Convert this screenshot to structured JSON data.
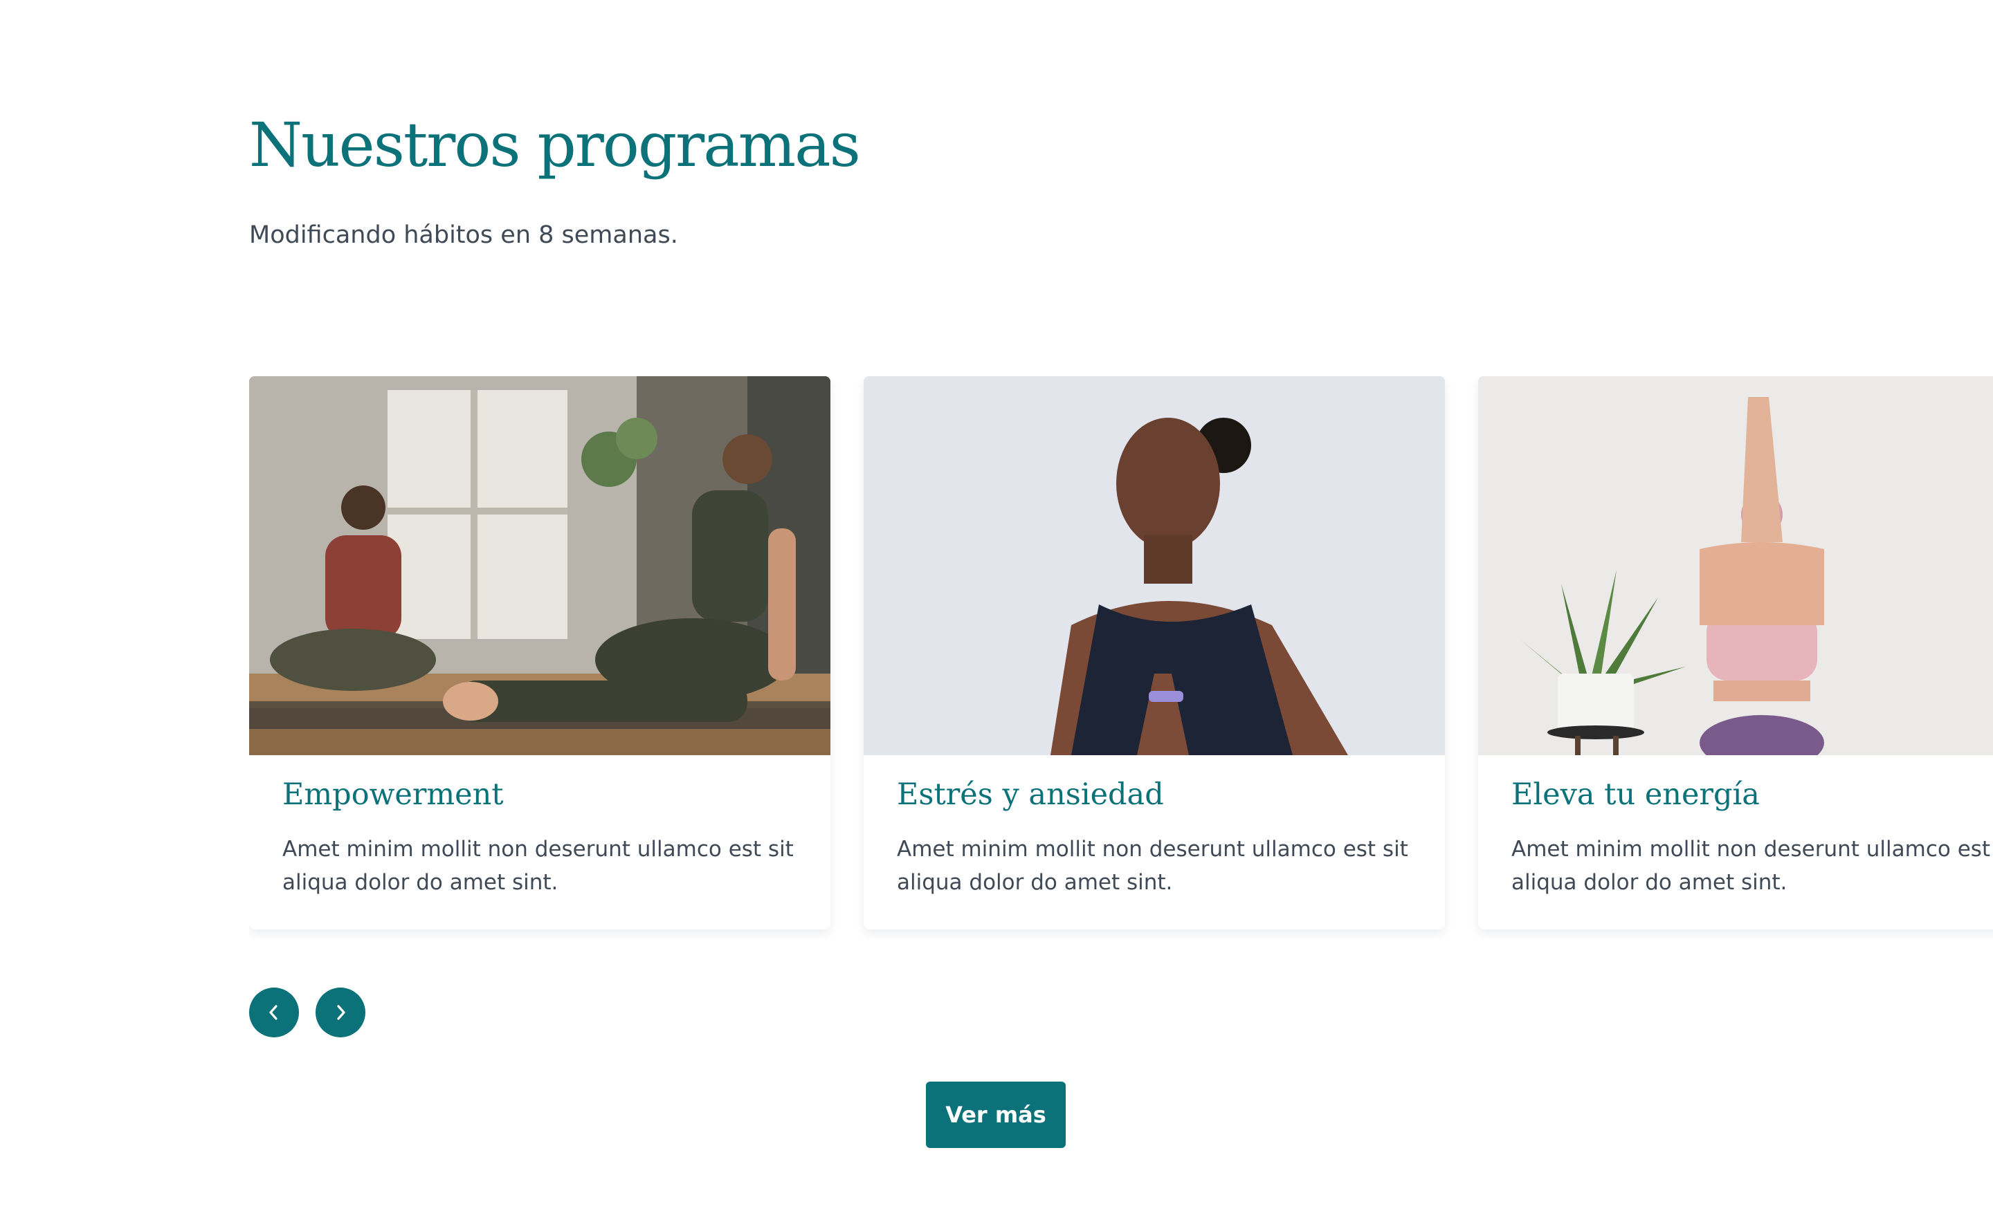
{
  "section": {
    "title": "Nuestros programas",
    "subtitle": "Modificando hábitos en 8 semanas."
  },
  "programs": [
    {
      "title": "Empowerment",
      "description_lines": [
        "Amet minim mollit non deserunt ullamco est sit",
        "aliqua dolor do amet sint."
      ],
      "image": "two-women-yoga-twist-photo"
    },
    {
      "title": "Estrés y ansiedad",
      "description_lines": [
        "Amet minim mollit non deserunt ullamco est sit",
        "aliqua dolor do amet sint."
      ],
      "image": "woman-meditating-prayer-hands-photo"
    },
    {
      "title": "Eleva tu energía",
      "description_lines": [
        "Amet minim mollit non deserunt ullamco est sit",
        "aliqua dolor do amet sint."
      ],
      "image": "woman-yoga-eagle-arms-plant-photo"
    }
  ],
  "carousel": {
    "prev_icon": "chevron-left-icon",
    "next_icon": "chevron-right-icon"
  },
  "cta": {
    "label": "Ver más"
  },
  "colors": {
    "brand": "#0c727a",
    "text": "#3f4a56",
    "background": "#ffffff"
  }
}
